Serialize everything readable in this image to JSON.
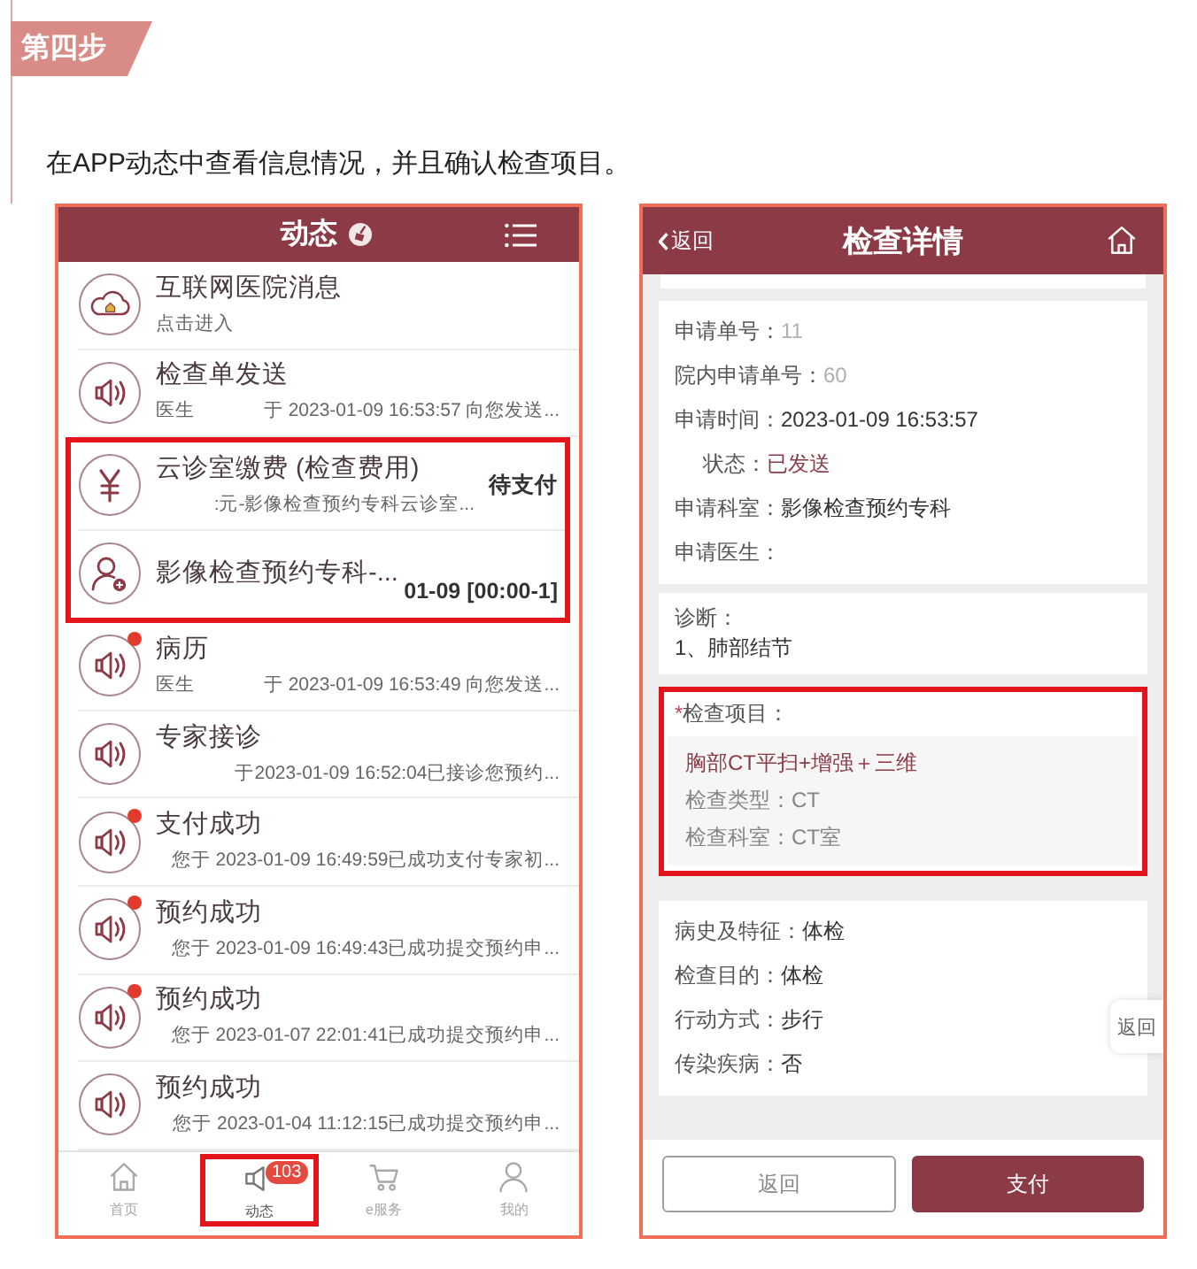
{
  "step_badge": "第四步",
  "instruction": "在APP动态中查看信息情况，并且确认检查项目。",
  "messages_screen": {
    "title": "动态",
    "messages": [
      {
        "kind": "portal",
        "title": "互联网医院消息",
        "text": "点击进入",
        "unread": false,
        "highlighted": false
      },
      {
        "kind": "speaker",
        "title": "检查单发送",
        "sender": "医生",
        "text": "于 2023-01-09 16:53:57 向您发送...",
        "unread": false,
        "highlighted": false
      },
      {
        "kind": "payment",
        "title": "云诊室缴费 (检查费用)",
        "text": ":元-影像检查预约专科云诊室...",
        "status": "待支付",
        "unread": false,
        "highlighted": true
      },
      {
        "kind": "appointment",
        "title": "影像检查预约专科-...",
        "status": "01-09 [00:00-1]",
        "unread": false,
        "highlighted": true
      },
      {
        "kind": "speaker",
        "title": "病历",
        "sender": "医生",
        "text": "于 2023-01-09 16:53:49 向您发送...",
        "unread": true,
        "highlighted": false
      },
      {
        "kind": "speaker",
        "title": "专家接诊",
        "text": "于2023-01-09 16:52:04已接诊您预约...",
        "unread": false,
        "highlighted": false
      },
      {
        "kind": "speaker",
        "title": "支付成功",
        "text": "您于 2023-01-09 16:49:59已成功支付专家初...",
        "unread": true,
        "highlighted": false
      },
      {
        "kind": "speaker",
        "title": "预约成功",
        "text": "您于 2023-01-09 16:49:43已成功提交预约申...",
        "unread": true,
        "highlighted": false
      },
      {
        "kind": "speaker",
        "title": "预约成功",
        "text": "您于 2023-01-07 22:01:41已成功提交预约申...",
        "unread": true,
        "highlighted": false
      },
      {
        "kind": "speaker",
        "title": "预约成功",
        "text": "您于 2023-01-04 11:12:15已成功提交预约申...",
        "unread": false,
        "highlighted": false
      }
    ],
    "tabs": [
      {
        "kind": "home",
        "label": "首页",
        "selected": false,
        "highlighted": false
      },
      {
        "kind": "speaker",
        "label": "动态",
        "selected": true,
        "badge": "103",
        "highlighted": true
      },
      {
        "kind": "cart",
        "label": "e服务",
        "selected": false,
        "highlighted": false
      },
      {
        "kind": "user",
        "label": "我的",
        "selected": false,
        "highlighted": false
      }
    ]
  },
  "detail_screen": {
    "back": "返回",
    "title": "检查详情",
    "sections": [
      {
        "kind": "fields",
        "highlighted": false,
        "fields": [
          {
            "kind": "masked",
            "label": "申请单号：",
            "value": "11"
          },
          {
            "kind": "masked",
            "label": "院内申请单号：",
            "value": "60"
          },
          {
            "kind": "plain",
            "label": "申请时间：",
            "value": "2023-01-09 16:53:57"
          },
          {
            "kind": "status",
            "label": "状态：",
            "value": "已发送"
          },
          {
            "kind": "plain",
            "label": "申请科室：",
            "value": "影像检查预约专科"
          },
          {
            "kind": "plain",
            "label": "申请医生："
          }
        ]
      },
      {
        "kind": "note",
        "highlighted": false,
        "label": "诊断：",
        "value": "1、肺部结节"
      },
      {
        "kind": "exam",
        "highlighted": true,
        "required_mark": "*",
        "label": "检查项目：",
        "item": "胸部CT平扫+增强＋三维",
        "fields": [
          {
            "kind": "plain",
            "label": "检查类型：",
            "value": "CT"
          },
          {
            "kind": "plain",
            "label": "检查科室：",
            "value": "CT室"
          }
        ]
      },
      {
        "kind": "fields",
        "highlighted": false,
        "fields": [
          {
            "kind": "plain",
            "label": "病史及特征：",
            "value": "体检"
          },
          {
            "kind": "plain",
            "label": "检查目的：",
            "value": "体检"
          },
          {
            "kind": "plain",
            "label": "行动方式：",
            "value": "步行"
          },
          {
            "kind": "plain",
            "label": "传染疾病：",
            "value": "否"
          }
        ]
      }
    ],
    "side_button": "返回",
    "buttons": [
      {
        "kind": "secondary",
        "label": "返回"
      },
      {
        "kind": "primary",
        "label": "支付"
      }
    ]
  }
}
